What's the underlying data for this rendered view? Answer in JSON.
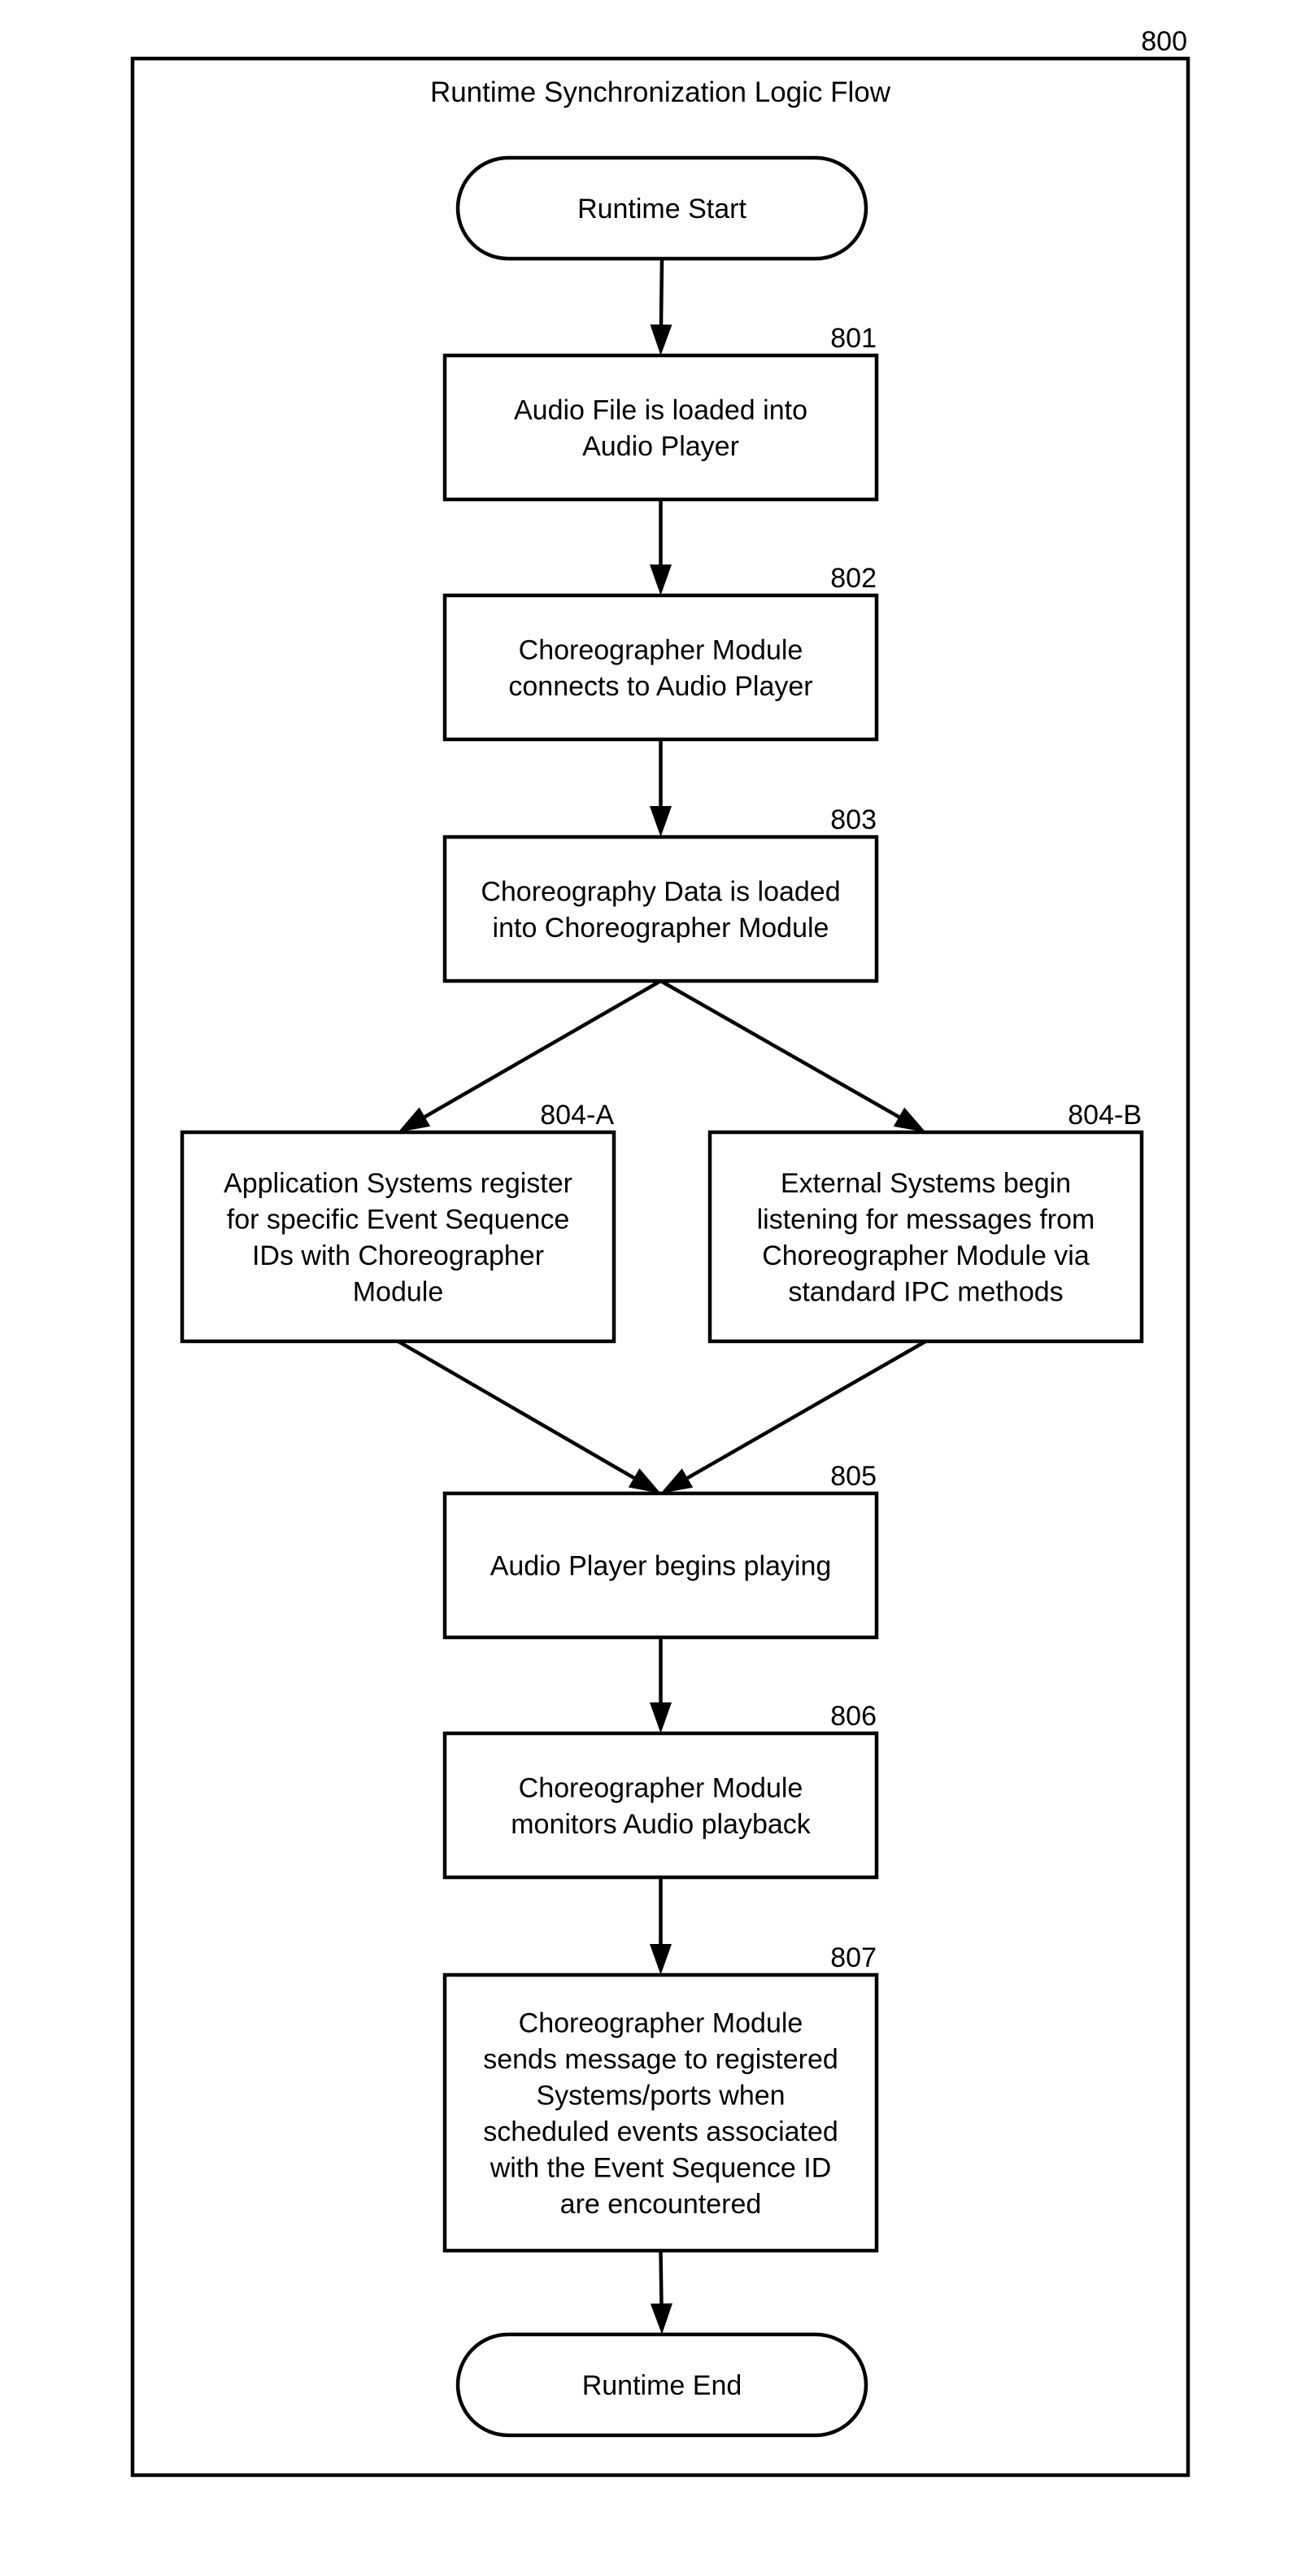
{
  "figure": {
    "ref": "800",
    "title": "Runtime Synchronization Logic Flow"
  },
  "nodes": {
    "start": {
      "type": "terminator",
      "label": [
        "Runtime Start"
      ]
    },
    "n801": {
      "type": "process",
      "ref": "801",
      "label": [
        "Audio File is loaded into",
        "Audio Player"
      ]
    },
    "n802": {
      "type": "process",
      "ref": "802",
      "label": [
        "Choreographer Module",
        "connects to Audio Player"
      ]
    },
    "n803": {
      "type": "process",
      "ref": "803",
      "label": [
        "Choreography Data is loaded",
        "into Choreographer Module"
      ]
    },
    "n804a": {
      "type": "process",
      "ref": "804-A",
      "label": [
        "Application Systems register",
        "for specific Event Sequence",
        "IDs with Choreographer",
        "Module"
      ]
    },
    "n804b": {
      "type": "process",
      "ref": "804-B",
      "label": [
        "External Systems begin",
        "listening for messages from",
        "Choreographer Module via",
        "standard IPC methods"
      ]
    },
    "n805": {
      "type": "process",
      "ref": "805",
      "label": [
        "Audio Player begins playing"
      ]
    },
    "n806": {
      "type": "process",
      "ref": "806",
      "label": [
        "Choreographer Module",
        "monitors Audio playback"
      ]
    },
    "n807": {
      "type": "process",
      "ref": "807",
      "label": [
        "Choreographer Module",
        "sends message to registered",
        "Systems/ports when",
        "scheduled events associated",
        "with the Event Sequence ID",
        "are encountered"
      ]
    },
    "end": {
      "type": "terminator",
      "label": [
        "Runtime End"
      ]
    }
  },
  "edges": [
    {
      "from": "start",
      "to": "n801"
    },
    {
      "from": "n801",
      "to": "n802"
    },
    {
      "from": "n802",
      "to": "n803"
    },
    {
      "from": "n803",
      "to": "n804a"
    },
    {
      "from": "n803",
      "to": "n804b"
    },
    {
      "from": "n804a",
      "to": "n805"
    },
    {
      "from": "n804b",
      "to": "n805"
    },
    {
      "from": "n805",
      "to": "n806"
    },
    {
      "from": "n806",
      "to": "n807"
    },
    {
      "from": "n807",
      "to": "end"
    }
  ]
}
